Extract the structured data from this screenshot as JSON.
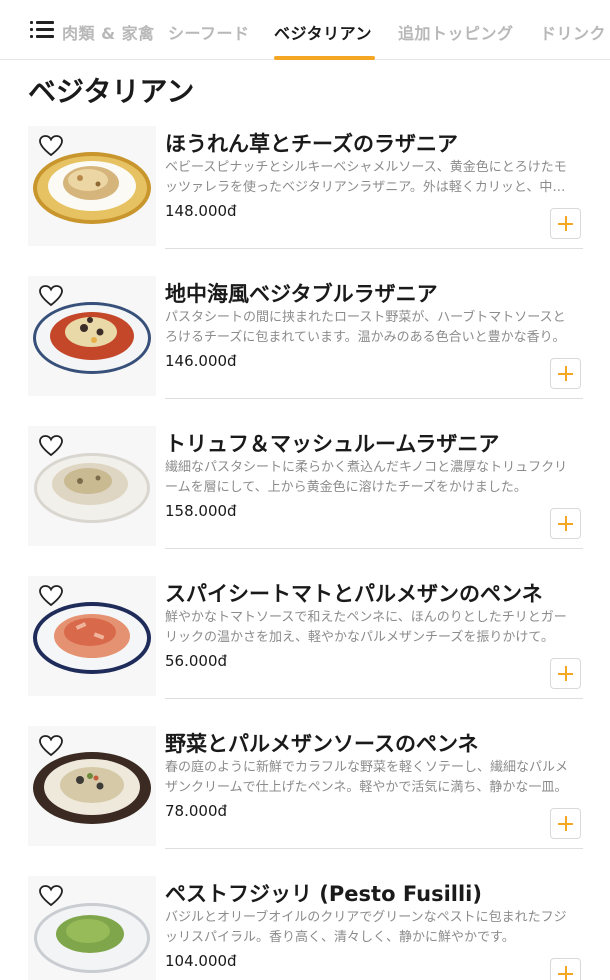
{
  "nav": {
    "menu_icon": "hamburger-menu-icon",
    "tabs": [
      {
        "label": "肉類 & 家禽"
      },
      {
        "label": "シーフード"
      },
      {
        "label": "ベジタリアン",
        "active": true
      },
      {
        "label": "追加トッピング"
      },
      {
        "label": "ドリンク"
      }
    ]
  },
  "section": {
    "title": "ベジタリアン"
  },
  "items": [
    {
      "name": "ほうれん草とチーズのラザニア",
      "description": "ベビースピナッチとシルキーベシャメルソース、黄金色にとろけたモッツァレラを使ったベジタリアンラザニア。外は軽くカリッと、中はしっとり。",
      "price": "148.000đ"
    },
    {
      "name": "地中海風ベジタブルラザニア",
      "description": "パスタシートの間に挟まれたロースト野菜が、ハーブトマトソースとろけるチーズに包まれています。温かみのある色合いと豊かな香り。",
      "price": "146.000đ"
    },
    {
      "name": "トリュフ＆マッシュルームラザニア",
      "description": "繊細なパスタシートに柔らかく煮込んだキノコと濃厚なトリュフクリームを層にして、上から黄金色に溶けたチーズをかけました。",
      "price": "158.000đ"
    },
    {
      "name": "スパイシートマトとパルメザンのペンネ",
      "description": "鮮やかなトマトソースで和えたペンネに、ほんのりとしたチリとガーリックの温かさを加え、軽やかなパルメザンチーズを振りかけて。",
      "price": "56.000đ"
    },
    {
      "name": "野菜とパルメザンソースのペンネ",
      "description": "春の庭のように新鮮でカラフルな野菜を軽くソテーし、繊細なパルメザンクリームで仕上げたペンネ。軽やかで活気に満ち、静かな一皿。",
      "price": "78.000đ"
    },
    {
      "name": "ペストフジッリ (Pesto Fusilli)",
      "description": "バジルとオリーブオイルのクリアでグリーンなペストに包まれたフジッリスパイラル。香り高く、清々しく、静かに鮮やかです。",
      "price": "104.000đ"
    }
  ],
  "colors": {
    "accent": "#f5a623",
    "text": "#1a1a1a",
    "muted": "#8c8c8c",
    "inactive_tab": "#b8b8b8"
  },
  "icons": {
    "favorite": "heart-outline-icon",
    "add": "plus-icon"
  }
}
